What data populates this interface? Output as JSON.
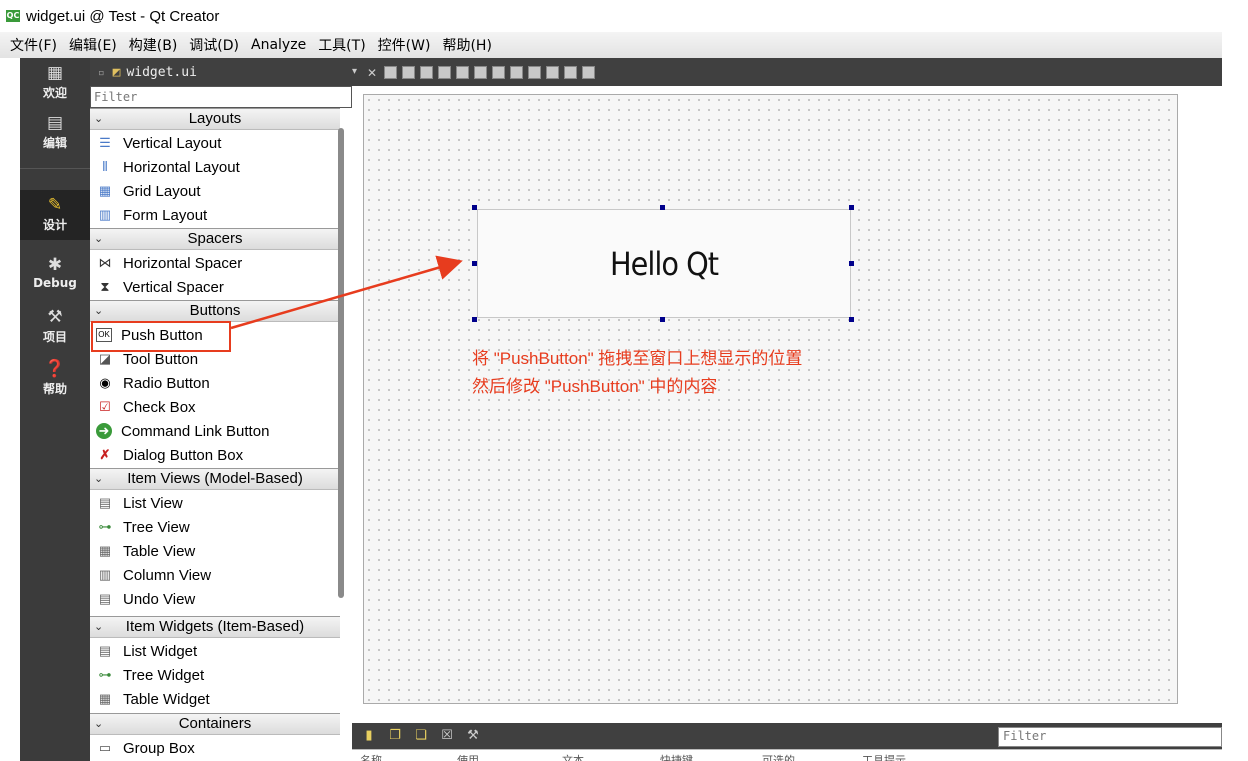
{
  "window": {
    "title": "widget.ui @ Test - Qt Creator",
    "app_icon": "QC"
  },
  "menu": [
    "文件(F)",
    "编辑(E)",
    "构建(B)",
    "调试(D)",
    "Analyze",
    "工具(T)",
    "控件(W)",
    "帮助(H)"
  ],
  "modes": [
    {
      "label": "欢迎",
      "icon": "grid-icon"
    },
    {
      "label": "编辑",
      "icon": "document-icon"
    },
    {
      "label": "设计",
      "icon": "pencil-icon",
      "active": true
    },
    {
      "label": "Debug",
      "icon": "bug-icon"
    },
    {
      "label": "项目",
      "icon": "wrench-icon"
    },
    {
      "label": "帮助",
      "icon": "help-icon"
    }
  ],
  "editor": {
    "filename": "widget.ui"
  },
  "widgetbox": {
    "filter_placeholder": "Filter",
    "categories": [
      {
        "name": "Layouts",
        "items": [
          "Vertical Layout",
          "Horizontal Layout",
          "Grid Layout",
          "Form Layout"
        ]
      },
      {
        "name": "Spacers",
        "items": [
          "Horizontal Spacer",
          "Vertical Spacer"
        ]
      },
      {
        "name": "Buttons",
        "items": [
          "Push Button",
          "Tool Button",
          "Radio Button",
          "Check Box",
          "Command Link Button",
          "Dialog Button Box"
        ]
      },
      {
        "name": "Item Views (Model-Based)",
        "items": [
          "List View",
          "Tree View",
          "Table View",
          "Column View",
          "Undo View"
        ]
      },
      {
        "name": "Item Widgets (Item-Based)",
        "items": [
          "List Widget",
          "Tree Widget",
          "Table Widget"
        ]
      },
      {
        "name": "Containers",
        "items": [
          "Group Box"
        ]
      }
    ]
  },
  "canvas": {
    "button_text": "Hello Qt",
    "annotation_line1": "将 \"PushButton\" 拖拽至窗口上想显示的位置",
    "annotation_line2": "然后修改 \"PushButton\" 中的内容",
    "annotation_color": "#e73c1e"
  },
  "bottom": {
    "filter_placeholder": "Filter",
    "columns": [
      "名称",
      "使用",
      "文本",
      "快捷键",
      "可选的",
      "工具提示"
    ]
  }
}
